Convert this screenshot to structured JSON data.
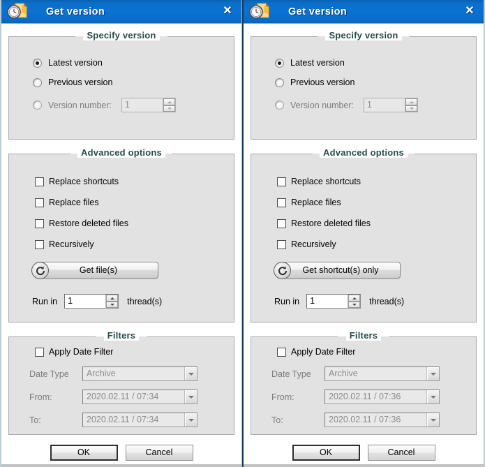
{
  "window": {
    "title": "Get version",
    "close_label": "✕",
    "icon": "stopwatch-document-icon"
  },
  "groups": {
    "specify_version": {
      "title": "Specify version",
      "options": [
        {
          "label": "Latest version",
          "selected": true
        },
        {
          "label": "Previous version",
          "selected": false
        },
        {
          "label": "Version number:",
          "selected": false
        }
      ],
      "version_number_value": "1"
    },
    "advanced_options": {
      "title": "Advanced options",
      "checkboxes": [
        {
          "label": "Replace shortcuts",
          "checked": false
        },
        {
          "label": "Replace files",
          "checked": false
        },
        {
          "label": "Restore deleted files",
          "checked": false
        },
        {
          "label": "Recursively",
          "checked": false
        }
      ],
      "run_in_label": "Run in",
      "threads_value": "1",
      "threads_label": "thread(s)"
    },
    "filters": {
      "title": "Filters",
      "apply_label": "Apply Date Filter",
      "apply_checked": false,
      "date_type_label": "Date Type",
      "date_type_value": "Archive",
      "from_label": "From:",
      "to_label": "To:"
    }
  },
  "panels": [
    {
      "id": "left",
      "action_button_label": "Get file(s)",
      "action_button_width": 172,
      "filters_from_value": "2020.02.11 / 07:34",
      "filters_to_value": "2020.02.11 / 07:34"
    },
    {
      "id": "right",
      "action_button_label": "Get shortcut(s) only",
      "action_button_width": 172,
      "filters_from_value": "2020.02.11 / 07:36",
      "filters_to_value": "2020.02.11 / 07:36"
    }
  ],
  "footer": {
    "ok_label": "OK",
    "cancel_label": "Cancel"
  },
  "colors": {
    "titlebar_blue": "#0b72d4",
    "group_bg": "#e2e2e2",
    "group_title": "#2b4a4a",
    "window_bg": "#ffffff"
  }
}
